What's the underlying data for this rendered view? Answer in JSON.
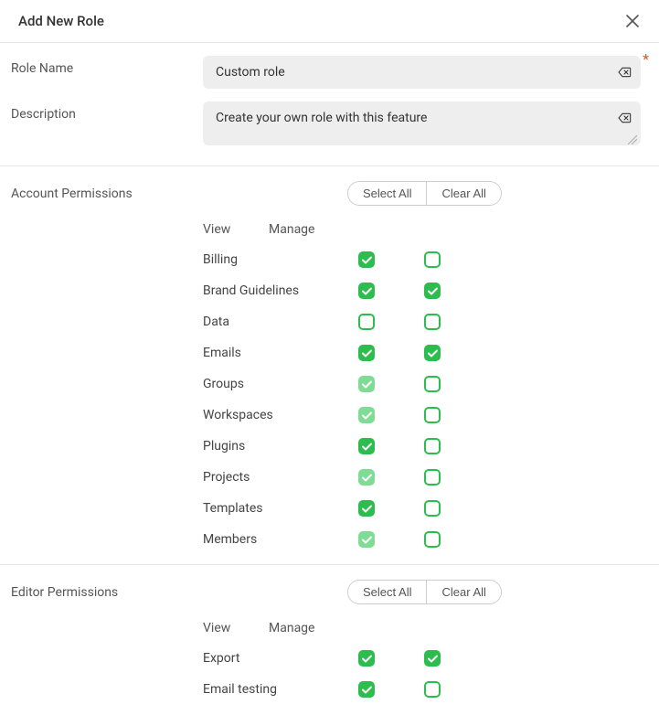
{
  "header": {
    "title": "Add New Role"
  },
  "fields": {
    "role_name_label": "Role Name",
    "role_name_value": "Custom role",
    "description_label": "Description",
    "description_value": "Create your own role with this feature"
  },
  "buttons": {
    "select_all": "Select All",
    "clear_all": "Clear All"
  },
  "columns": {
    "view": "View",
    "manage": "Manage"
  },
  "sections": [
    {
      "title": "Account Permissions",
      "permissions": [
        {
          "label": "Billing",
          "view": "checked",
          "manage": "unchecked"
        },
        {
          "label": "Brand Guidelines",
          "view": "checked",
          "manage": "checked"
        },
        {
          "label": "Data",
          "view": "unchecked",
          "manage": "unchecked"
        },
        {
          "label": "Emails",
          "view": "checked",
          "manage": "checked"
        },
        {
          "label": "Groups",
          "view": "dim",
          "manage": "unchecked"
        },
        {
          "label": "Workspaces",
          "view": "dim",
          "manage": "unchecked"
        },
        {
          "label": "Plugins",
          "view": "checked",
          "manage": "unchecked"
        },
        {
          "label": "Projects",
          "view": "dim",
          "manage": "unchecked"
        },
        {
          "label": "Templates",
          "view": "checked",
          "manage": "unchecked"
        },
        {
          "label": "Members",
          "view": "dim",
          "manage": "unchecked"
        }
      ]
    },
    {
      "title": "Editor Permissions",
      "permissions": [
        {
          "label": "Export",
          "view": "checked",
          "manage": "checked"
        },
        {
          "label": "Email testing",
          "view": "checked",
          "manage": "unchecked"
        }
      ]
    }
  ]
}
